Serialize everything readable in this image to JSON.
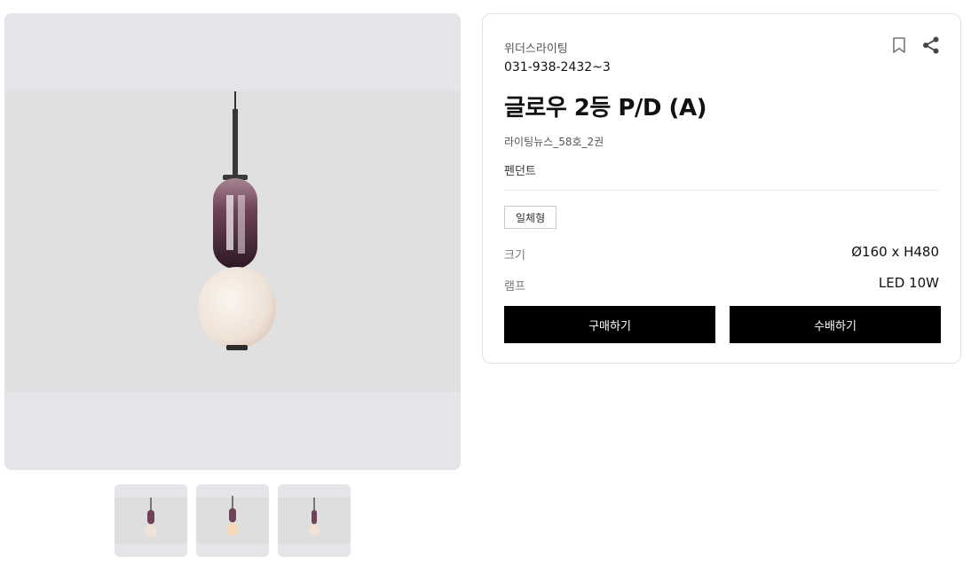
{
  "product": {
    "brand": "위더스라이팅",
    "phone": "031-938-2432~3",
    "title": "글로우 2등 P/D (A)",
    "source": "라이팅뉴스_58호_2권",
    "category": "펜던트",
    "tag": "일체형",
    "specs": [
      {
        "label": "크기",
        "value": "Ø160 x H480"
      },
      {
        "label": "램프",
        "value": "LED 10W"
      }
    ]
  },
  "buttons": {
    "buy": "구매하기",
    "delivery": "수배하기"
  },
  "icons": {
    "bookmark": "bookmark-icon",
    "share": "share-icon"
  },
  "colors": {
    "button_bg": "#000000",
    "gallery_bg": "#e4e5e9",
    "shade_top": "#4a2a3a",
    "globe": "#efe3d8"
  }
}
